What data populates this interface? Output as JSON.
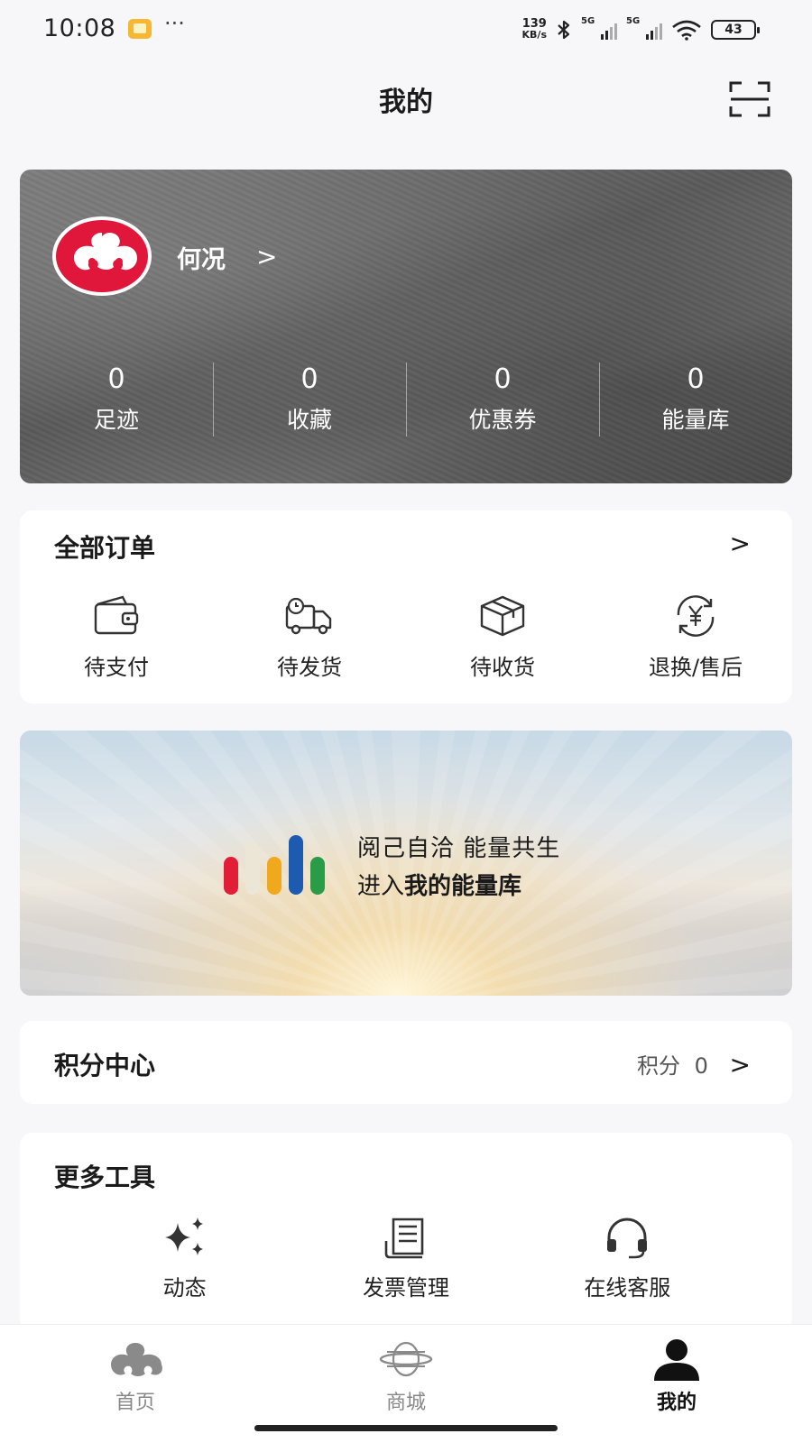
{
  "status_bar": {
    "time": "10:08",
    "more": "···",
    "net_speed_value": "139",
    "net_speed_unit": "KB/s",
    "signal_tag_1": "5G",
    "signal_tag_2": "5G",
    "battery": "43"
  },
  "header": {
    "title": "我的",
    "scan_icon": "scan-icon"
  },
  "profile": {
    "name": "何况",
    "chevron": ">",
    "stats": [
      {
        "value": "0",
        "label": "足迹"
      },
      {
        "value": "0",
        "label": "收藏"
      },
      {
        "value": "0",
        "label": "优惠券"
      },
      {
        "value": "0",
        "label": "能量库"
      }
    ]
  },
  "orders": {
    "title": "全部订单",
    "chevron": ">",
    "items": [
      {
        "label": "待支付",
        "icon": "wallet-icon"
      },
      {
        "label": "待发货",
        "icon": "delivery-truck-icon"
      },
      {
        "label": "待收货",
        "icon": "package-box-icon"
      },
      {
        "label": "退换/售后",
        "icon": "refund-yen-icon"
      }
    ]
  },
  "energy_banner": {
    "line1": "阅己自洽  能量共生",
    "line2_prefix": "进入",
    "line2_bold": "我的能量库",
    "bar_colors": [
      "#e11d38",
      "#e8e3d3",
      "#f0a81c",
      "#1d5bb0",
      "#2a9c48"
    ]
  },
  "points": {
    "title": "积分中心",
    "label": "积分",
    "value": "0",
    "chevron": ">"
  },
  "tools": {
    "title": "更多工具",
    "items": [
      {
        "label": "动态",
        "icon": "sparkle-icon"
      },
      {
        "label": "发票管理",
        "icon": "invoice-icon"
      },
      {
        "label": "在线客服",
        "icon": "headset-icon"
      }
    ]
  },
  "tab_bar": {
    "tabs": [
      {
        "label": "首页",
        "icon": "home-cloud-icon",
        "active": false
      },
      {
        "label": "商城",
        "icon": "mall-icon",
        "active": false
      },
      {
        "label": "我的",
        "icon": "person-icon",
        "active": true
      }
    ]
  },
  "colors": {
    "brand_red": "#e0163a",
    "background": "#f7f6f8"
  }
}
